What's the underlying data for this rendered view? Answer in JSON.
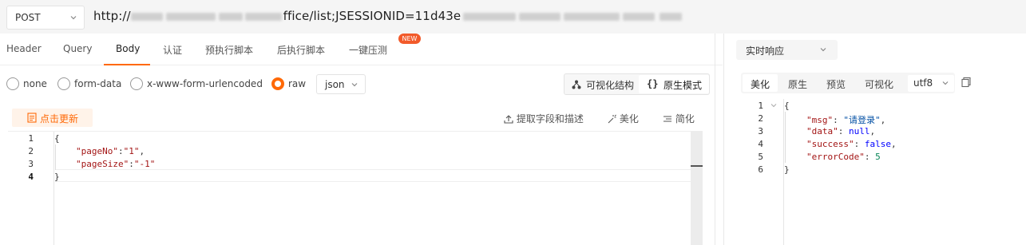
{
  "request": {
    "method": "POST",
    "url_prefix": "http://",
    "url_suffix": "ffice/list;JSESSIONID=11d43e",
    "tabs": [
      "Header",
      "Query",
      "Body",
      "认证",
      "预执行脚本",
      "后执行脚本",
      "一键压测"
    ],
    "active_tab": "Body",
    "new_badge": "NEW",
    "body_types": [
      "none",
      "form-data",
      "x-www-form-urlencoded",
      "raw"
    ],
    "selected_body_type": "raw",
    "format": "json",
    "modes": [
      "可视化结构",
      "原生模式"
    ],
    "active_mode": "原生模式",
    "update_button": "点击更新",
    "tools": [
      "提取字段和描述",
      "美化",
      "简化"
    ]
  },
  "editor": {
    "line_numbers": [
      "1",
      "2",
      "3",
      "4"
    ],
    "brace_open": "{",
    "brace_close": "}",
    "fields": [
      {
        "key": "\"pageNo\"",
        "sep": ":",
        "value": "\"1\"",
        "trail": ","
      },
      {
        "key": "\"pageSize\"",
        "sep": ":",
        "value": "\"-1\"",
        "trail": ""
      }
    ]
  },
  "response": {
    "view_select": "实时响应",
    "tabs": [
      "美化",
      "原生",
      "预览",
      "可视化"
    ],
    "active_tab": "美化",
    "encoding": "utf8",
    "line_numbers": [
      "1",
      "2",
      "3",
      "4",
      "5",
      "6"
    ],
    "brace_open": "{",
    "brace_close": "}",
    "fields": [
      {
        "key": "\"msg\"",
        "value": "\"请登录\"",
        "kind": "str",
        "trail": ","
      },
      {
        "key": "\"data\"",
        "value": "null",
        "kind": "lit",
        "trail": ","
      },
      {
        "key": "\"success\"",
        "value": "false",
        "kind": "lit",
        "trail": ","
      },
      {
        "key": "\"errorCode\"",
        "value": "5",
        "kind": "num",
        "trail": ""
      }
    ]
  },
  "colors": {
    "accent": "#ff6907",
    "badge": "#f25a2a",
    "json_key": "#a31515",
    "json_string": "#0451a5",
    "json_literal": "#0000ff",
    "json_number": "#098658"
  }
}
